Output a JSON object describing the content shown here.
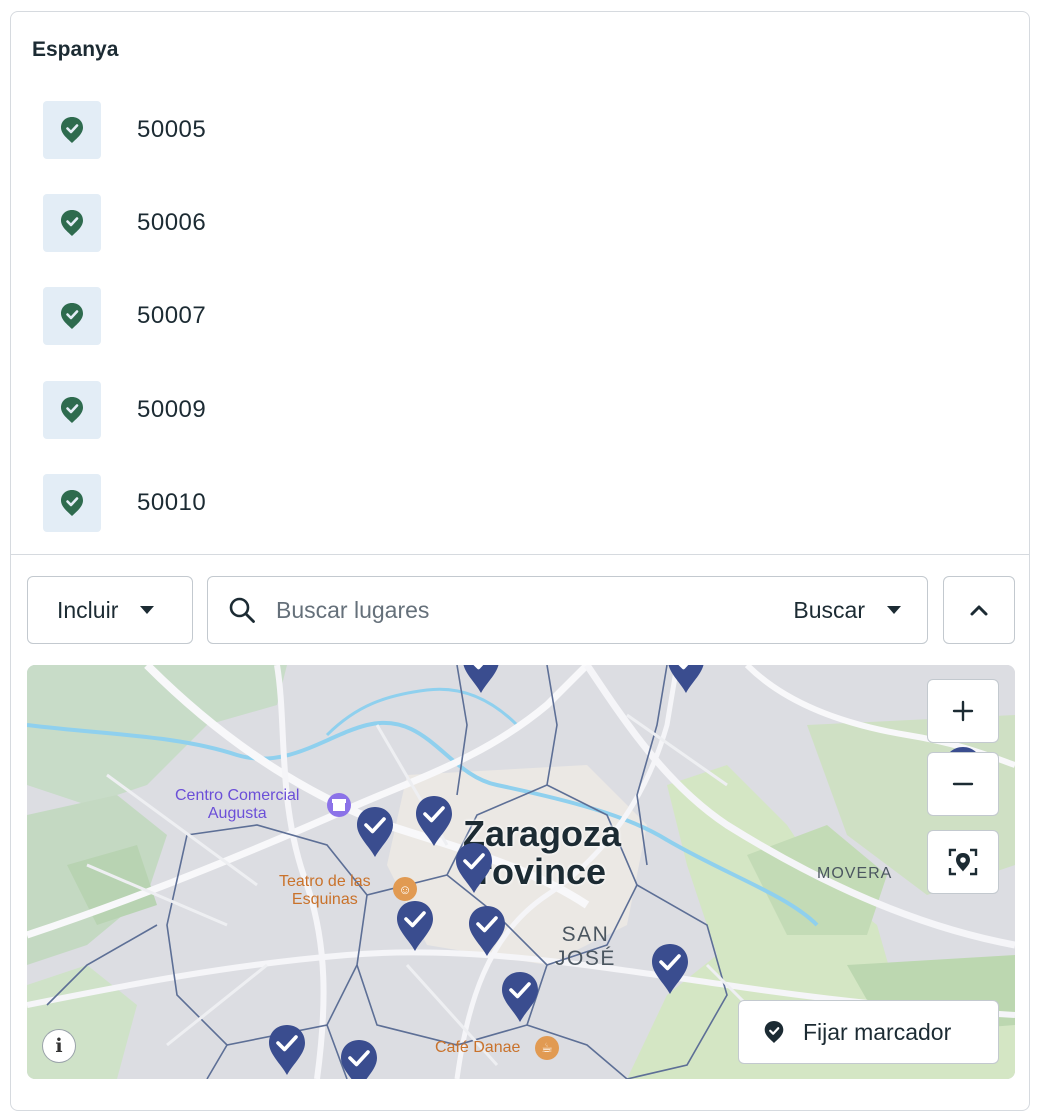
{
  "section": {
    "country": "Espanya"
  },
  "locations": [
    {
      "label": "50005"
    },
    {
      "label": "50006"
    },
    {
      "label": "50007"
    },
    {
      "label": "50009"
    },
    {
      "label": "50010"
    }
  ],
  "filters": {
    "include_label": "Incluir",
    "search_placeholder": "Buscar lugares",
    "search_type_label": "Buscar"
  },
  "map": {
    "city_label_line1": "Zaragoza",
    "city_label_line2": "rovince",
    "district_label_line1": "SAN",
    "district_label_line2": "JOSÉ",
    "area_label": "MOVERA",
    "poi_mall_line1": "Centro Comercial",
    "poi_mall_line2": "Augusta",
    "poi_theatre_line1": "Teatro de las",
    "poi_theatre_line2": "Esquinas",
    "poi_cafe": "Café Danae",
    "info_label": "i",
    "fijar_label": "Fijar marcador"
  },
  "colors": {
    "pin": "#3a4d8f",
    "location_icon": "#2e6b4e",
    "location_icon_bg": "#e3edf6",
    "mall_poi": "#6b4fd8",
    "food_poi": "#d78838"
  },
  "icons": {
    "location": "shield-check-pin-icon",
    "search": "search-icon",
    "collapse": "chevron-up-icon",
    "zoom_in": "plus-icon",
    "zoom_out": "minus-icon",
    "locate": "locate-pin-icon",
    "fijar": "pin-icon",
    "info": "info-icon"
  }
}
